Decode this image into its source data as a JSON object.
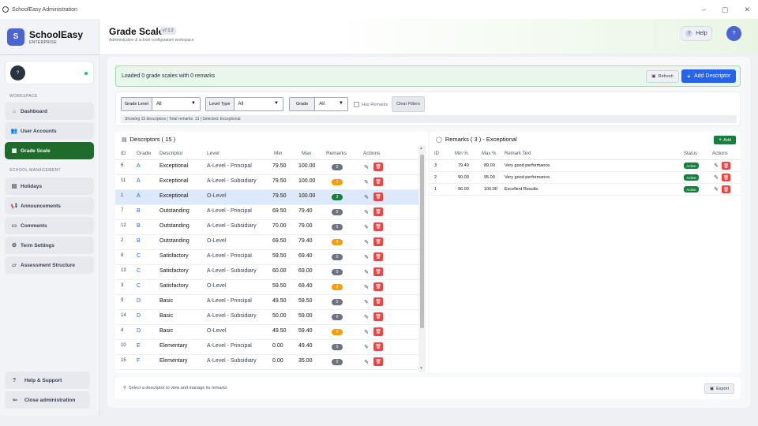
{
  "window": {
    "title": "SchoolEasy Administration",
    "controls": [
      "–",
      "▢",
      "✕"
    ]
  },
  "brand": {
    "logo_letter": "S",
    "name": "SchoolEasy",
    "sub": "ENTERPRISE"
  },
  "user": {
    "avatar": "?"
  },
  "sidebar": {
    "workspace_label": "WORKSPACE",
    "workspace_items": [
      {
        "label": "Dashboard",
        "icon": "home-icon"
      },
      {
        "label": "User Accounts",
        "icon": "users-icon"
      },
      {
        "label": "Grade Scale",
        "icon": "grid-icon",
        "active": true
      }
    ],
    "management_label": "SCHOOL MANAGEMENT",
    "management_items": [
      {
        "label": "Holidays",
        "icon": "calendar-icon"
      },
      {
        "label": "Announcements",
        "icon": "megaphone-icon"
      },
      {
        "label": "Comments",
        "icon": "comment-icon"
      },
      {
        "label": "Term Settings",
        "icon": "gear-icon"
      },
      {
        "label": "Assessment Structure",
        "icon": "folder-icon"
      }
    ],
    "help_label": "Help & Support",
    "close_label": "Close administration"
  },
  "header": {
    "title": "Grade Scale",
    "version": "v7.1.2",
    "subtitle": "Administration & school configuration workspace",
    "help_label": "Help",
    "avatar": "?"
  },
  "notice": {
    "text": "Loaded 0 grade scales with 0 remarks",
    "refresh_label": "Refresh",
    "add_label": "Add Descriptor"
  },
  "filters": {
    "grade_level_label": "Grade Level",
    "grade_level_value": "All",
    "level_type_label": "Level Type",
    "level_type_value": "All",
    "grade_label": "Grade",
    "grade_value": "All",
    "has_remarks_label": "Has Remarks",
    "clear_label": "Clear Filters",
    "summary": "Showing  15  descriptors  |  Total remarks:  13  |  Selected:  Exceptional"
  },
  "descriptors": {
    "title": "Descriptors ( 15 )",
    "columns": [
      "ID",
      "Grade",
      "Descriptor",
      "Level",
      "Min",
      "Max",
      "Remarks",
      "Actions"
    ],
    "rows": [
      {
        "id": "6",
        "grade": "A",
        "descriptor": "Exceptional",
        "level": "A-Level - Principal",
        "min": "79.50",
        "max": "100.00",
        "remarks": "0",
        "pill": "gray"
      },
      {
        "id": "11",
        "grade": "A",
        "descriptor": "Exceptional",
        "level": "A-Level - Subsidiary",
        "min": "79.50",
        "max": "100.00",
        "remarks": "1",
        "pill": "amber"
      },
      {
        "id": "1",
        "grade": "A",
        "descriptor": "Exceptional",
        "level": "O-Level",
        "min": "79.50",
        "max": "100.00",
        "remarks": "3",
        "pill": "green",
        "selected": true
      },
      {
        "id": "7",
        "grade": "B",
        "descriptor": "Outstanding",
        "level": "A-Level - Principal",
        "min": "69.50",
        "max": "79.40",
        "remarks": "0",
        "pill": "gray"
      },
      {
        "id": "12",
        "grade": "B",
        "descriptor": "Outstanding",
        "level": "A-Level - Subsidiary",
        "min": "70.00",
        "max": "79.00",
        "remarks": "0",
        "pill": "gray"
      },
      {
        "id": "2",
        "grade": "B",
        "descriptor": "Outstanding",
        "level": "O-Level",
        "min": "69.50",
        "max": "79.40",
        "remarks": "3",
        "pill": "amber"
      },
      {
        "id": "8",
        "grade": "C",
        "descriptor": "Satisfactory",
        "level": "A-Level - Principal",
        "min": "59.50",
        "max": "69.40",
        "remarks": "0",
        "pill": "gray"
      },
      {
        "id": "13",
        "grade": "C",
        "descriptor": "Satisfactory",
        "level": "A-Level - Subsidiary",
        "min": "60.00",
        "max": "69.00",
        "remarks": "0",
        "pill": "gray"
      },
      {
        "id": "3",
        "grade": "C",
        "descriptor": "Satisfactory",
        "level": "O-Level",
        "min": "59.50",
        "max": "69.40",
        "remarks": "2",
        "pill": "amber"
      },
      {
        "id": "9",
        "grade": "D",
        "descriptor": "Basic",
        "level": "A-Level - Principal",
        "min": "49.50",
        "max": "59.50",
        "remarks": "0",
        "pill": "gray"
      },
      {
        "id": "14",
        "grade": "D",
        "descriptor": "Basic",
        "level": "A-Level - Subsidiary",
        "min": "50.00",
        "max": "59.00",
        "remarks": "0",
        "pill": "gray"
      },
      {
        "id": "4",
        "grade": "D",
        "descriptor": "Basic",
        "level": "O-Level",
        "min": "49.50",
        "max": "59.40",
        "remarks": "2",
        "pill": "amber"
      },
      {
        "id": "10",
        "grade": "E",
        "descriptor": "Elementary",
        "level": "A-Level - Principal",
        "min": "0.00",
        "max": "49.40",
        "remarks": "0",
        "pill": "gray"
      },
      {
        "id": "15",
        "grade": "F",
        "descriptor": "Elementary",
        "level": "A-Level - Subsidiary",
        "min": "0.00",
        "max": "35.00",
        "remarks": "0",
        "pill": "gray"
      }
    ]
  },
  "remarks": {
    "title": "Remarks ( 3 )  -  Exceptional",
    "add_label": "Add",
    "columns": [
      "ID",
      "Min %",
      "Max %",
      "Remark Text",
      "Status",
      "Actions"
    ],
    "rows": [
      {
        "id": "3",
        "min": "79.40",
        "max": "89.00",
        "text": "Very good performance.",
        "status": "Active"
      },
      {
        "id": "2",
        "min": "90.00",
        "max": "95.00",
        "text": "Very good performance.",
        "status": "Active"
      },
      {
        "id": "1",
        "min": "96.00",
        "max": "100.00",
        "text": "Excellent Results.",
        "status": "Active"
      }
    ]
  },
  "footer": {
    "hint": "Select a descriptor to view and manage its remarks",
    "export_label": "Export"
  }
}
